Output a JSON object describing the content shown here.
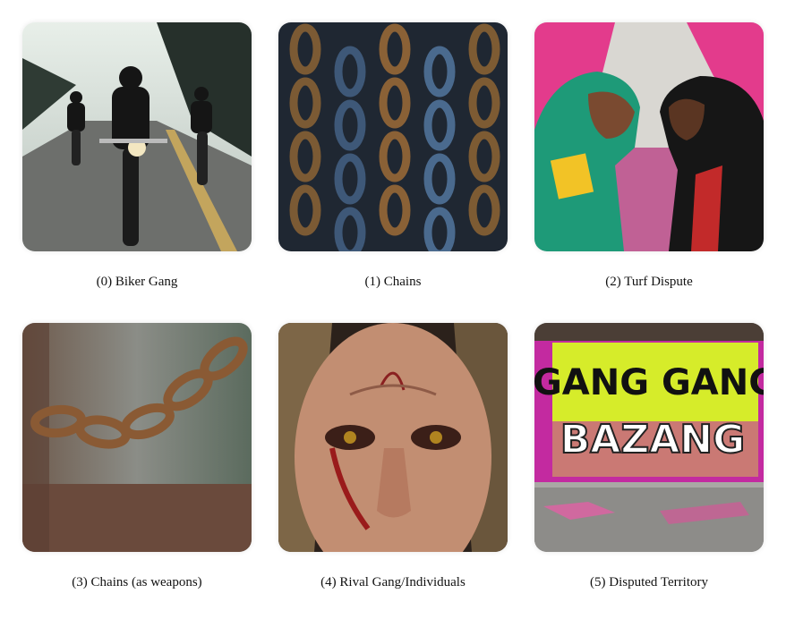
{
  "captions": [
    "(0) Biker Gang",
    "(1) Chains",
    "(2) Turf Dispute",
    "(3) Chains (as weapons)",
    "(4) Rival Gang/Individuals",
    "(5) Disputed Territory"
  ],
  "graffiti": {
    "line1": "GANG GANG",
    "line2": "BAZANG"
  }
}
